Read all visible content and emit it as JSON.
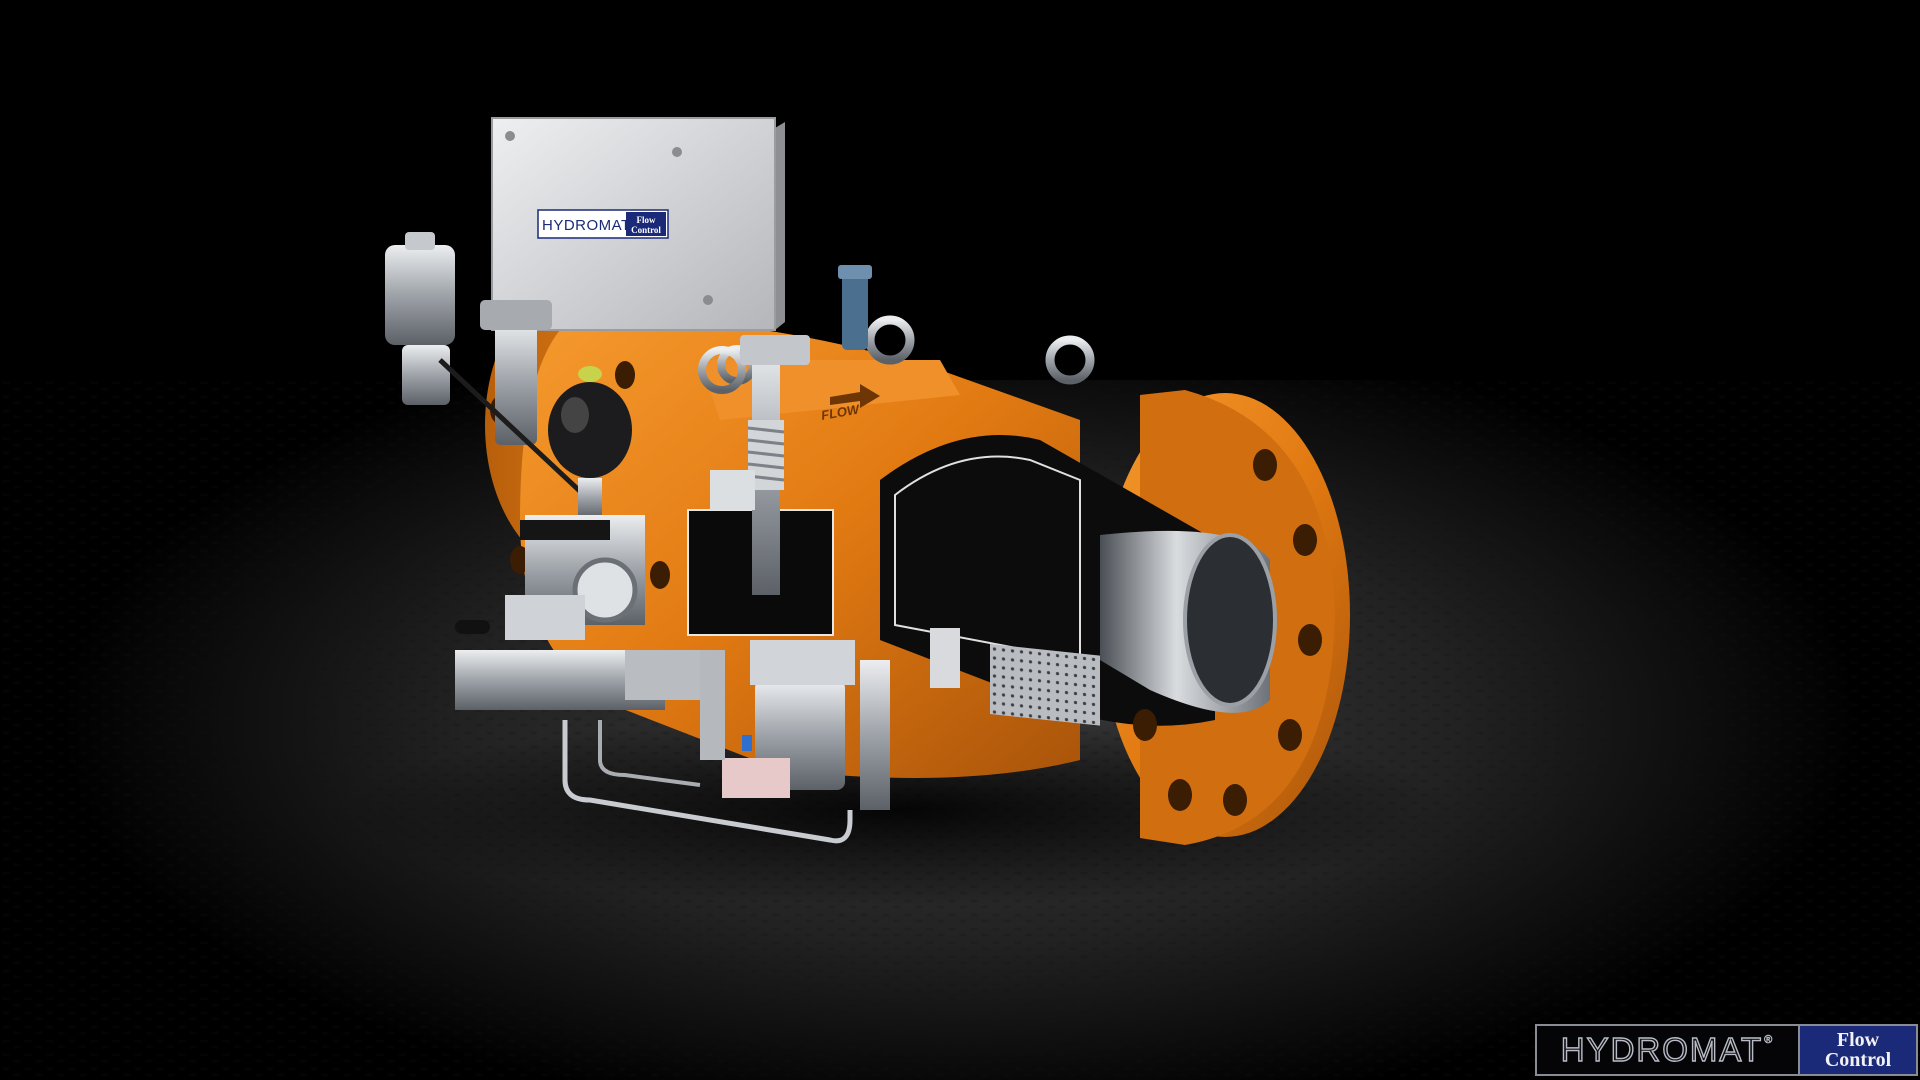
{
  "box_logo": {
    "word": "HYDROMAT",
    "flow": "Flow",
    "control": "Control"
  },
  "flow_marking": "FLOW",
  "brand": {
    "word": "HYDROMAT",
    "registered": "®",
    "flow": "Flow",
    "control": "Control"
  },
  "colors": {
    "background": "#000000",
    "floor": "#262626",
    "valve_body": "#e07a12",
    "steel": "#b8bcc2",
    "electrical_box": "#d8d9dc",
    "brand_blue": "#1b2a78"
  }
}
